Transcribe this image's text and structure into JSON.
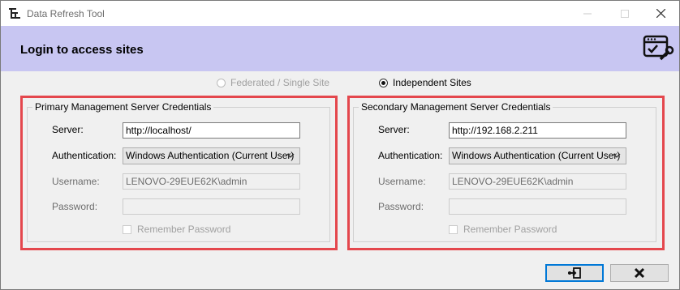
{
  "window": {
    "title": "Data Refresh Tool",
    "icons": {
      "app": "tree-structure-icon",
      "minimize": "minimize-icon",
      "maximize": "maximize-icon",
      "close": "close-icon"
    }
  },
  "banner": {
    "title": "Login to access sites",
    "icon": "window-check-wrench-icon",
    "background": "#c8c6f2"
  },
  "site_mode": {
    "options": [
      {
        "label": "Federated / Single Site",
        "selected": false,
        "enabled": false
      },
      {
        "label": "Independent Sites",
        "selected": true,
        "enabled": true
      }
    ]
  },
  "primary": {
    "title": "Primary Management Server Credentials",
    "server_label": "Server:",
    "server_value": "http://localhost/",
    "auth_label": "Authentication:",
    "auth_value": "Windows Authentication (Current User)",
    "username_label": "Username:",
    "username_value": "LENOVO-29EUE62K\\admin",
    "password_label": "Password:",
    "password_value": "",
    "remember_label": "Remember Password",
    "remember_checked": false
  },
  "secondary": {
    "title": "Secondary Management Server Credentials",
    "server_label": "Server:",
    "server_value": "http://192.168.2.211",
    "auth_label": "Authentication:",
    "auth_value": "Windows Authentication (Current User)",
    "username_label": "Username:",
    "username_value": "LENOVO-29EUE62K\\admin",
    "password_label": "Password:",
    "password_value": "",
    "remember_label": "Remember Password",
    "remember_checked": false
  },
  "buttons": {
    "login_icon": "login-icon",
    "cancel_icon": "close-x-icon"
  },
  "colors": {
    "highlight": "#e4474d",
    "focus": "#0078d7"
  }
}
